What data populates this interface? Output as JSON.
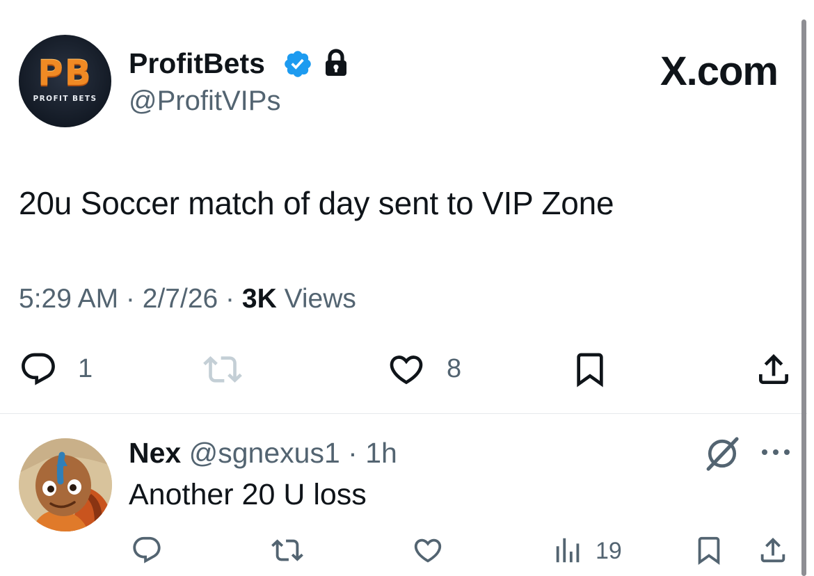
{
  "tweet": {
    "avatar": {
      "mark": "PB",
      "sub": "PROFIT BETS"
    },
    "display_name": "ProfitBets",
    "handle": "@ProfitVIPs",
    "badges": [
      "verified-icon",
      "lock-icon"
    ],
    "watermark": "X.com",
    "text": "20u Soccer match of day sent to VIP Zone",
    "meta": {
      "time": "5:29 AM",
      "sep1": " · ",
      "date": "2/7/26",
      "sep2": " · ",
      "views_count": "3K",
      "views_label": " Views"
    },
    "actions": {
      "reply_count": "1",
      "like_count": "8"
    }
  },
  "reply": {
    "name": "Nex",
    "handle": "@sgnexus1",
    "dot": " · ",
    "time": "1h",
    "text": "Another 20 U loss",
    "views_count": "19"
  },
  "colors": {
    "text": "#0f1419",
    "muted": "#536471",
    "verified": "#1d9bf0",
    "divider": "#e6e9ec"
  }
}
